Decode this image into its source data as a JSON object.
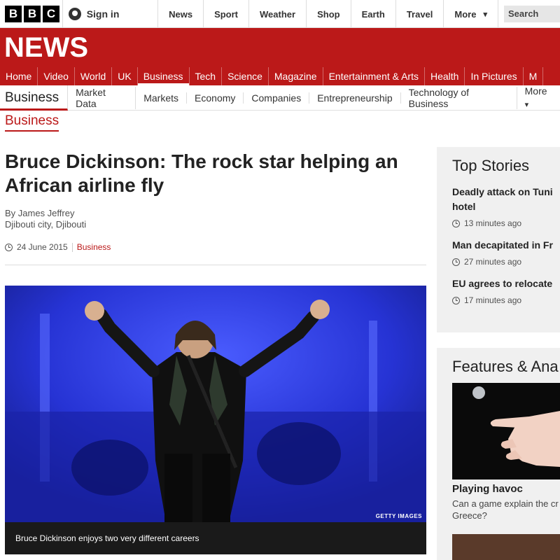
{
  "topbar": {
    "logo_letters": [
      "B",
      "B",
      "C"
    ],
    "signin_label": "Sign in",
    "nav": [
      "News",
      "Sport",
      "Weather",
      "Shop",
      "Earth",
      "Travel"
    ],
    "more_label": "More",
    "search_placeholder": "Search"
  },
  "banner": {
    "wordmark": "NEWS",
    "color": "#bb1919"
  },
  "section_nav": {
    "items": [
      "Home",
      "Video",
      "World",
      "UK",
      "Business",
      "Tech",
      "Science",
      "Magazine",
      "Entertainment & Arts",
      "Health",
      "In Pictures",
      "M"
    ],
    "active": "Business"
  },
  "sub_nav": {
    "section": "Business",
    "items": [
      "Market Data",
      "Markets",
      "Economy",
      "Companies",
      "Entrepreneurship",
      "Technology of Business"
    ],
    "more_label": "More"
  },
  "section_label": "Business",
  "article": {
    "headline": "Bruce Dickinson: The rock star helping an African airline fly",
    "author": "By James Jeffrey",
    "location": "Djibouti city, Djibouti",
    "date": "24 June 2015",
    "tag": "Business",
    "image_credit": "GETTY IMAGES",
    "caption": "Bruce Dickinson enjoys two very different careers"
  },
  "top_stories": {
    "title": "Top Stories",
    "items": [
      {
        "title_lines": [
          "Deadly attack on Tuni",
          "hotel"
        ],
        "time": "13 minutes ago"
      },
      {
        "title_lines": [
          "Man decapitated in Fr"
        ],
        "time": "27 minutes ago"
      },
      {
        "title_lines": [
          "EU agrees to relocate"
        ],
        "time": "17 minutes ago"
      }
    ]
  },
  "features": {
    "title": "Features & Ana",
    "item_title": "Playing havoc",
    "item_summary_lines": [
      "Can a game explain the cr",
      "Greece?"
    ]
  }
}
